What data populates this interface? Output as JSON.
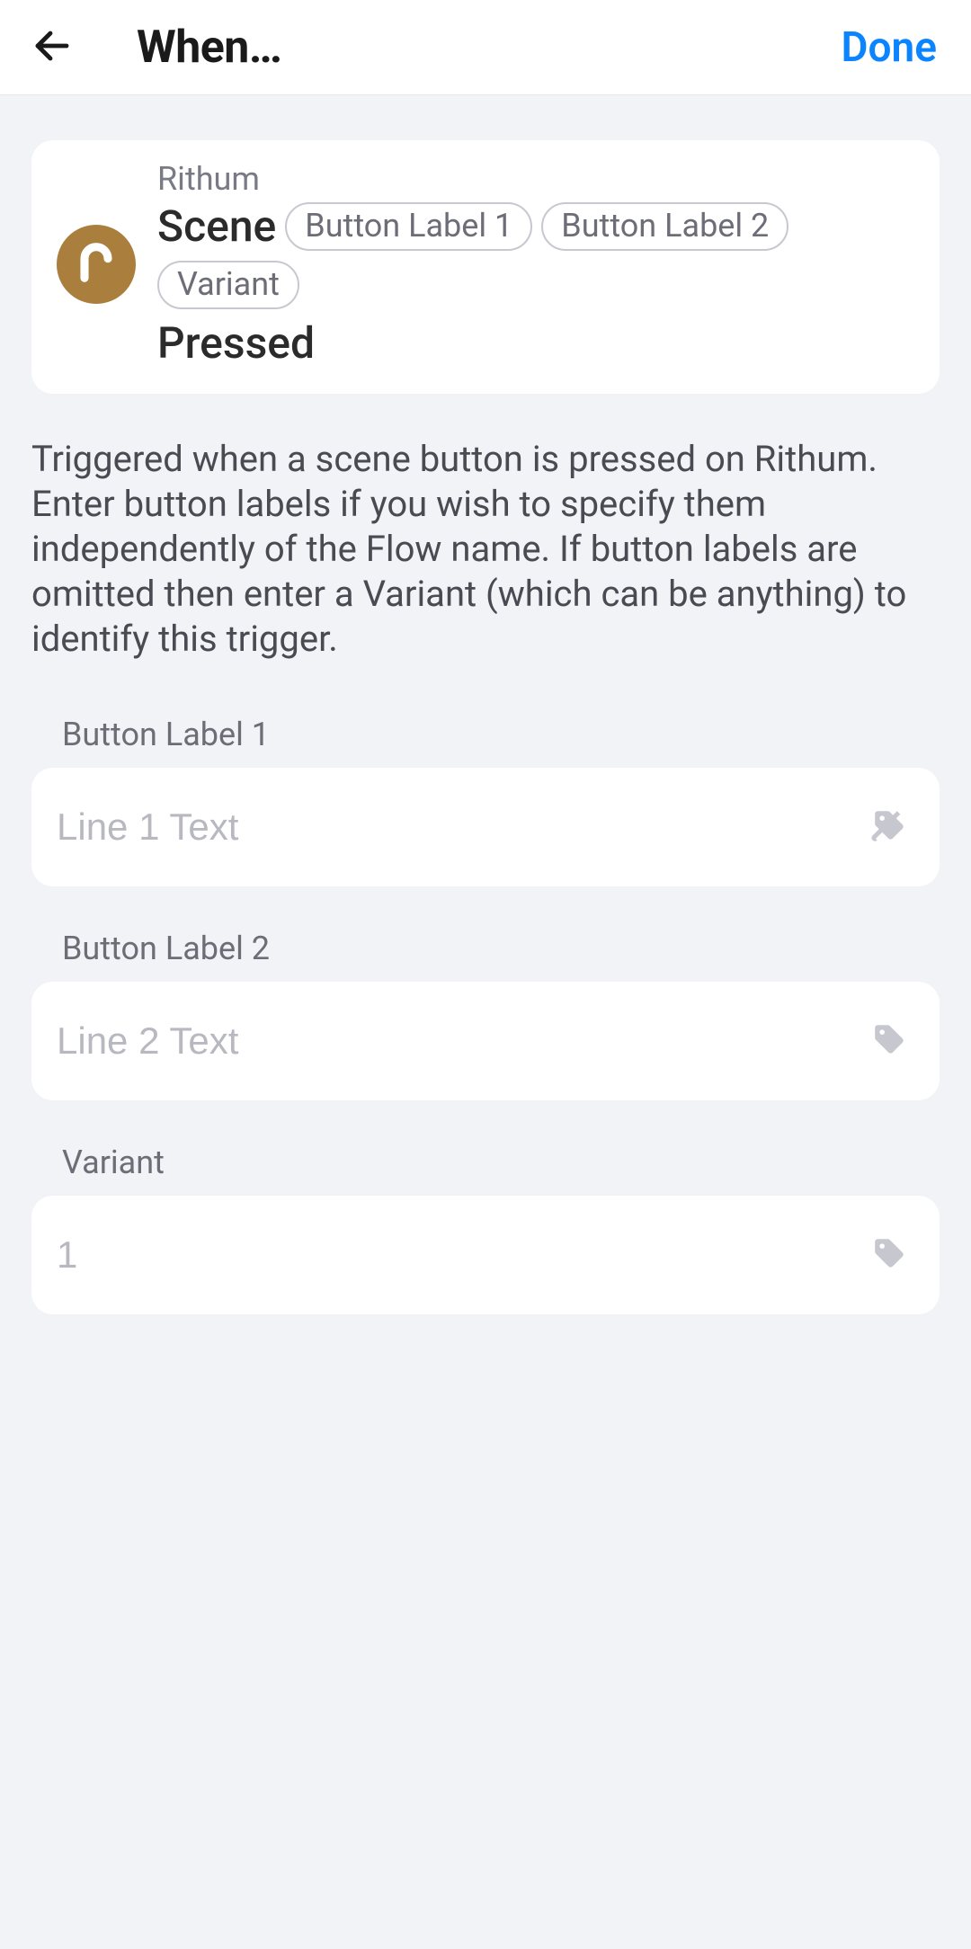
{
  "header": {
    "title": "When…",
    "done_label": "Done"
  },
  "card": {
    "app_name": "Rithum",
    "line1_pre": "Scene",
    "chip1": "Button Label 1",
    "chip2": "Button Label 2",
    "chip3": "Variant",
    "line2_post": "Pressed"
  },
  "description": "Triggered when a scene button is pressed on Rithum.\nEnter button labels if you wish to specify them independently of the Flow name. If button labels are omitted then enter a Variant (which can be anything) to identify this trigger.",
  "fields": [
    {
      "label": "Button Label 1",
      "placeholder": "Line 1 Text",
      "value": ""
    },
    {
      "label": "Button Label 2",
      "placeholder": "Line 2 Text",
      "value": ""
    },
    {
      "label": "Variant",
      "placeholder": "1",
      "value": ""
    }
  ],
  "colors": {
    "accent": "#0a84ff",
    "brand_circle": "#aa7f3e"
  }
}
